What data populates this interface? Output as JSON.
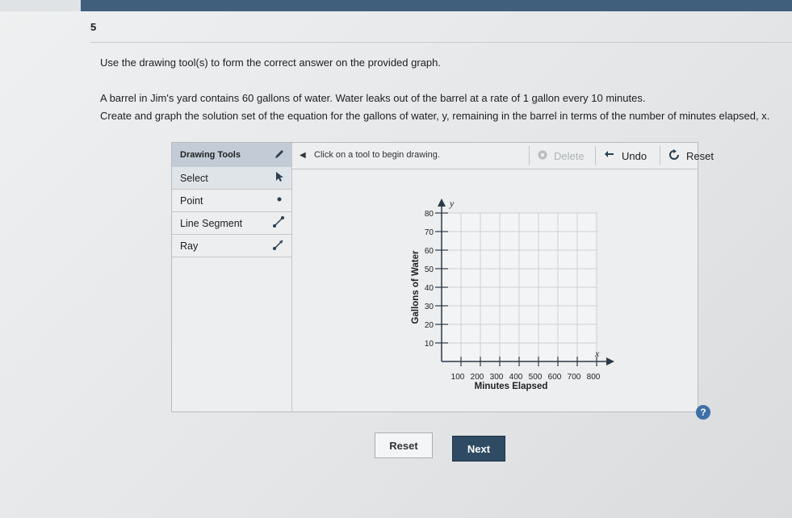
{
  "question": {
    "number": "5",
    "instruction": "Use the drawing tool(s) to form the correct answer on the provided graph.",
    "scenario": "A barrel in Jim's yard contains 60 gallons of water. Water leaks out of the barrel at a rate of 1 gallon every 10 minutes.",
    "task": "Create and graph the solution set of the equation for the gallons of water, y, remaining in the barrel in terms of the number of minutes elapsed, x."
  },
  "tools": {
    "header": "Drawing Tools",
    "items": [
      {
        "label": "Select",
        "icon": "pointer-icon"
      },
      {
        "label": "Point",
        "icon": "point-icon"
      },
      {
        "label": "Line Segment",
        "icon": "line-segment-icon"
      },
      {
        "label": "Ray",
        "icon": "ray-icon"
      }
    ]
  },
  "toolbar": {
    "hint": "Click on a tool to begin drawing.",
    "delete_label": "Delete",
    "undo_label": "Undo",
    "reset_label": "Reset"
  },
  "graph": {
    "x_axis_letter": "x",
    "y_axis_letter": "y",
    "x_label": "Minutes Elapsed",
    "y_label": "Gallons of Water",
    "x_ticks": [
      "100",
      "200",
      "300",
      "400",
      "500",
      "600",
      "700",
      "800"
    ],
    "y_ticks": [
      "10",
      "20",
      "30",
      "40",
      "50",
      "60",
      "70",
      "80"
    ]
  },
  "footer": {
    "reset_label": "Reset",
    "next_label": "Next",
    "help_label": "?"
  }
}
